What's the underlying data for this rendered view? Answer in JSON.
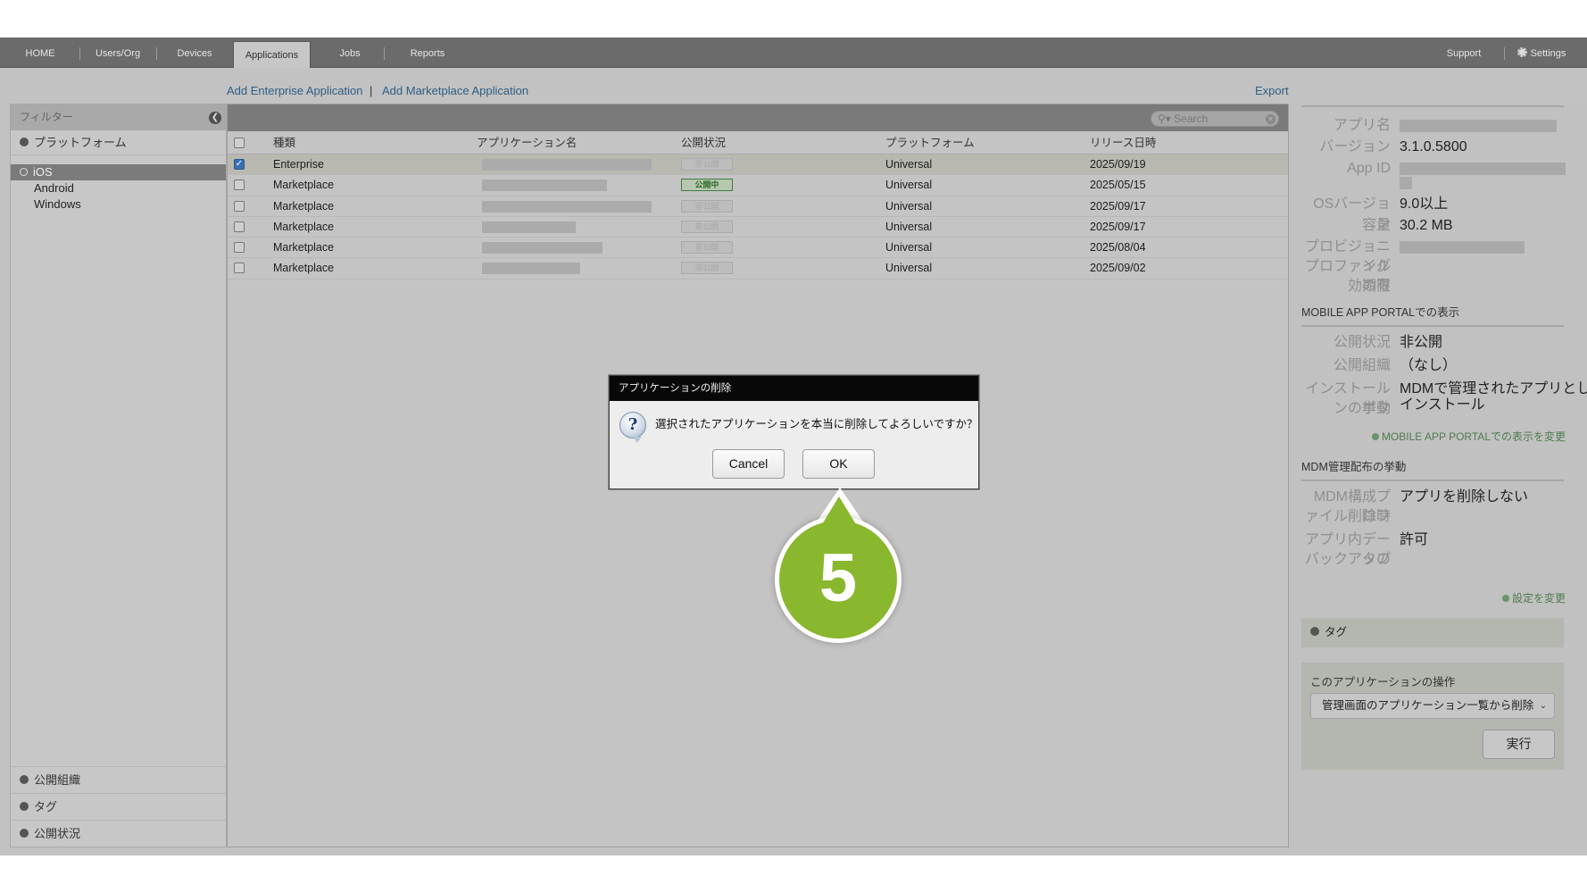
{
  "nav": {
    "items": [
      "HOME",
      "Users/Org",
      "Devices",
      "Applications",
      "Jobs",
      "Reports"
    ],
    "active": "Applications",
    "support": "Support",
    "settings": "Settings"
  },
  "actions": {
    "add_enterprise": "Add Enterprise Application",
    "separator": "|",
    "add_marketplace": "Add Marketplace Application",
    "export": "Export"
  },
  "filter": {
    "title": "フィルター",
    "platform_section": "プラットフォーム",
    "platforms": [
      "iOS",
      "Android",
      "Windows"
    ],
    "selected_platform": "iOS",
    "bottom_sections": [
      "公開組織",
      "タグ",
      "公開状況"
    ]
  },
  "search": {
    "placeholder": "Search"
  },
  "table": {
    "columns": [
      "種類",
      "アプリケーション名",
      "公開状況",
      "プラットフォーム",
      "リリース日時"
    ],
    "rows": [
      {
        "type": "Enterprise",
        "status": "非公開",
        "platform": "Universal",
        "date": "2025/09/19",
        "checked": true
      },
      {
        "type": "Marketplace",
        "status": "公開中",
        "platform": "Universal",
        "date": "2025/05/15",
        "checked": false
      },
      {
        "type": "Marketplace",
        "status": "非公開",
        "platform": "Universal",
        "date": "2025/09/17",
        "checked": false
      },
      {
        "type": "Marketplace",
        "status": "非公開",
        "platform": "Universal",
        "date": "2025/09/17",
        "checked": false
      },
      {
        "type": "Marketplace",
        "status": "非公開",
        "platform": "Universal",
        "date": "2025/08/04",
        "checked": false
      },
      {
        "type": "Marketplace",
        "status": "非公開",
        "platform": "Universal",
        "date": "2025/09/02",
        "checked": false
      }
    ]
  },
  "details": {
    "app_name_label": "アプリ名",
    "version_label": "バージョン",
    "version": "3.1.0.5800",
    "app_id_label": "App ID",
    "os_version_label": "OSバージョン",
    "os_version": "9.0以上",
    "size_label": "容量",
    "size": "30.2 MB",
    "provisioning_label_1": "プロビジョニング",
    "provisioning_label_2": "プロファイルの有",
    "provisioning_label_3": "効期限",
    "portal_section": "MOBILE APP PORTALでの表示",
    "portal_status_label": "公開状況",
    "portal_status": "非公開",
    "portal_org_label": "公開組織",
    "portal_org": "（なし）",
    "install_button_label_1": "インストールボタ",
    "install_button_label_2": "ンの挙動",
    "install_behavior_1": "MDMで管理されたアプリとして",
    "install_behavior_2": "インストール",
    "portal_change_link": "MOBILE APP PORTALでの表示を変更",
    "mdm_section": "MDM管理配布の挙動",
    "mdm_profile_label_1": "MDM構成プロフ",
    "mdm_profile_label_2": "ァイル削除時",
    "mdm_profile_value": "アプリを削除しない",
    "backup_label_1": "アプリ内データの",
    "backup_label_2": "バックアップ",
    "backup_value": "許可",
    "settings_change_link": "設定を変更",
    "tag_section": "タグ",
    "operation_title": "このアプリケーションの操作",
    "operation_selected": "管理画面のアプリケーション一覧から削除",
    "execute_button": "実行"
  },
  "dialog": {
    "title": "アプリケーションの削除",
    "message": "選択されたアプリケーションを本当に削除してよろしいですか？",
    "cancel": "Cancel",
    "ok": "OK"
  },
  "callout": {
    "number": "5",
    "color": "#89b72d"
  }
}
